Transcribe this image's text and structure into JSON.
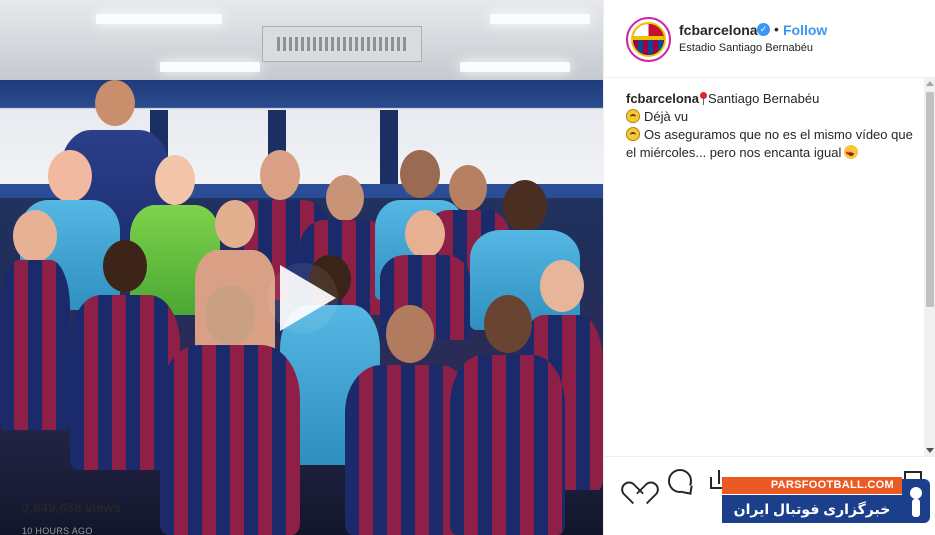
{
  "post": {
    "username": "fcbarcelona",
    "verified_mark": "✓",
    "separator": "•",
    "follow_label": "Follow",
    "location": "Estadio Santiago Bernabéu"
  },
  "caption": {
    "user": "fcbarcelona",
    "line1_text": "Santiago Bernabéu",
    "line2_text": "Déjà vu",
    "line3_text": "Os aseguramos que no es el mismo vídeo que el miércoles... pero nos encanta igual"
  },
  "stats": {
    "views_count": "3,849,638",
    "views_label": "views",
    "timestamp": "10 HOURS AGO"
  },
  "watermark": {
    "top_text": "PARSFOOTBALL.COM",
    "bottom_text": "خبرگزاری فوتبال ایران"
  },
  "icons": {
    "media": "play-icon",
    "avatar": "fc-barcelona-crest",
    "location": "pin-icon",
    "caption": [
      "pin-icon",
      "person-raising-hands-emoji",
      "person-raising-hands-emoji",
      "heart-eyes-emoji"
    ],
    "actions": [
      "heart-icon",
      "comment-icon",
      "share-icon",
      "bookmark-icon"
    ]
  },
  "colors": {
    "link": "#3897f0",
    "watermark_orange": "#ec5a24",
    "watermark_blue": "#1c3f8c",
    "barca_blue": "#004d98",
    "barca_garnet": "#a50044"
  }
}
